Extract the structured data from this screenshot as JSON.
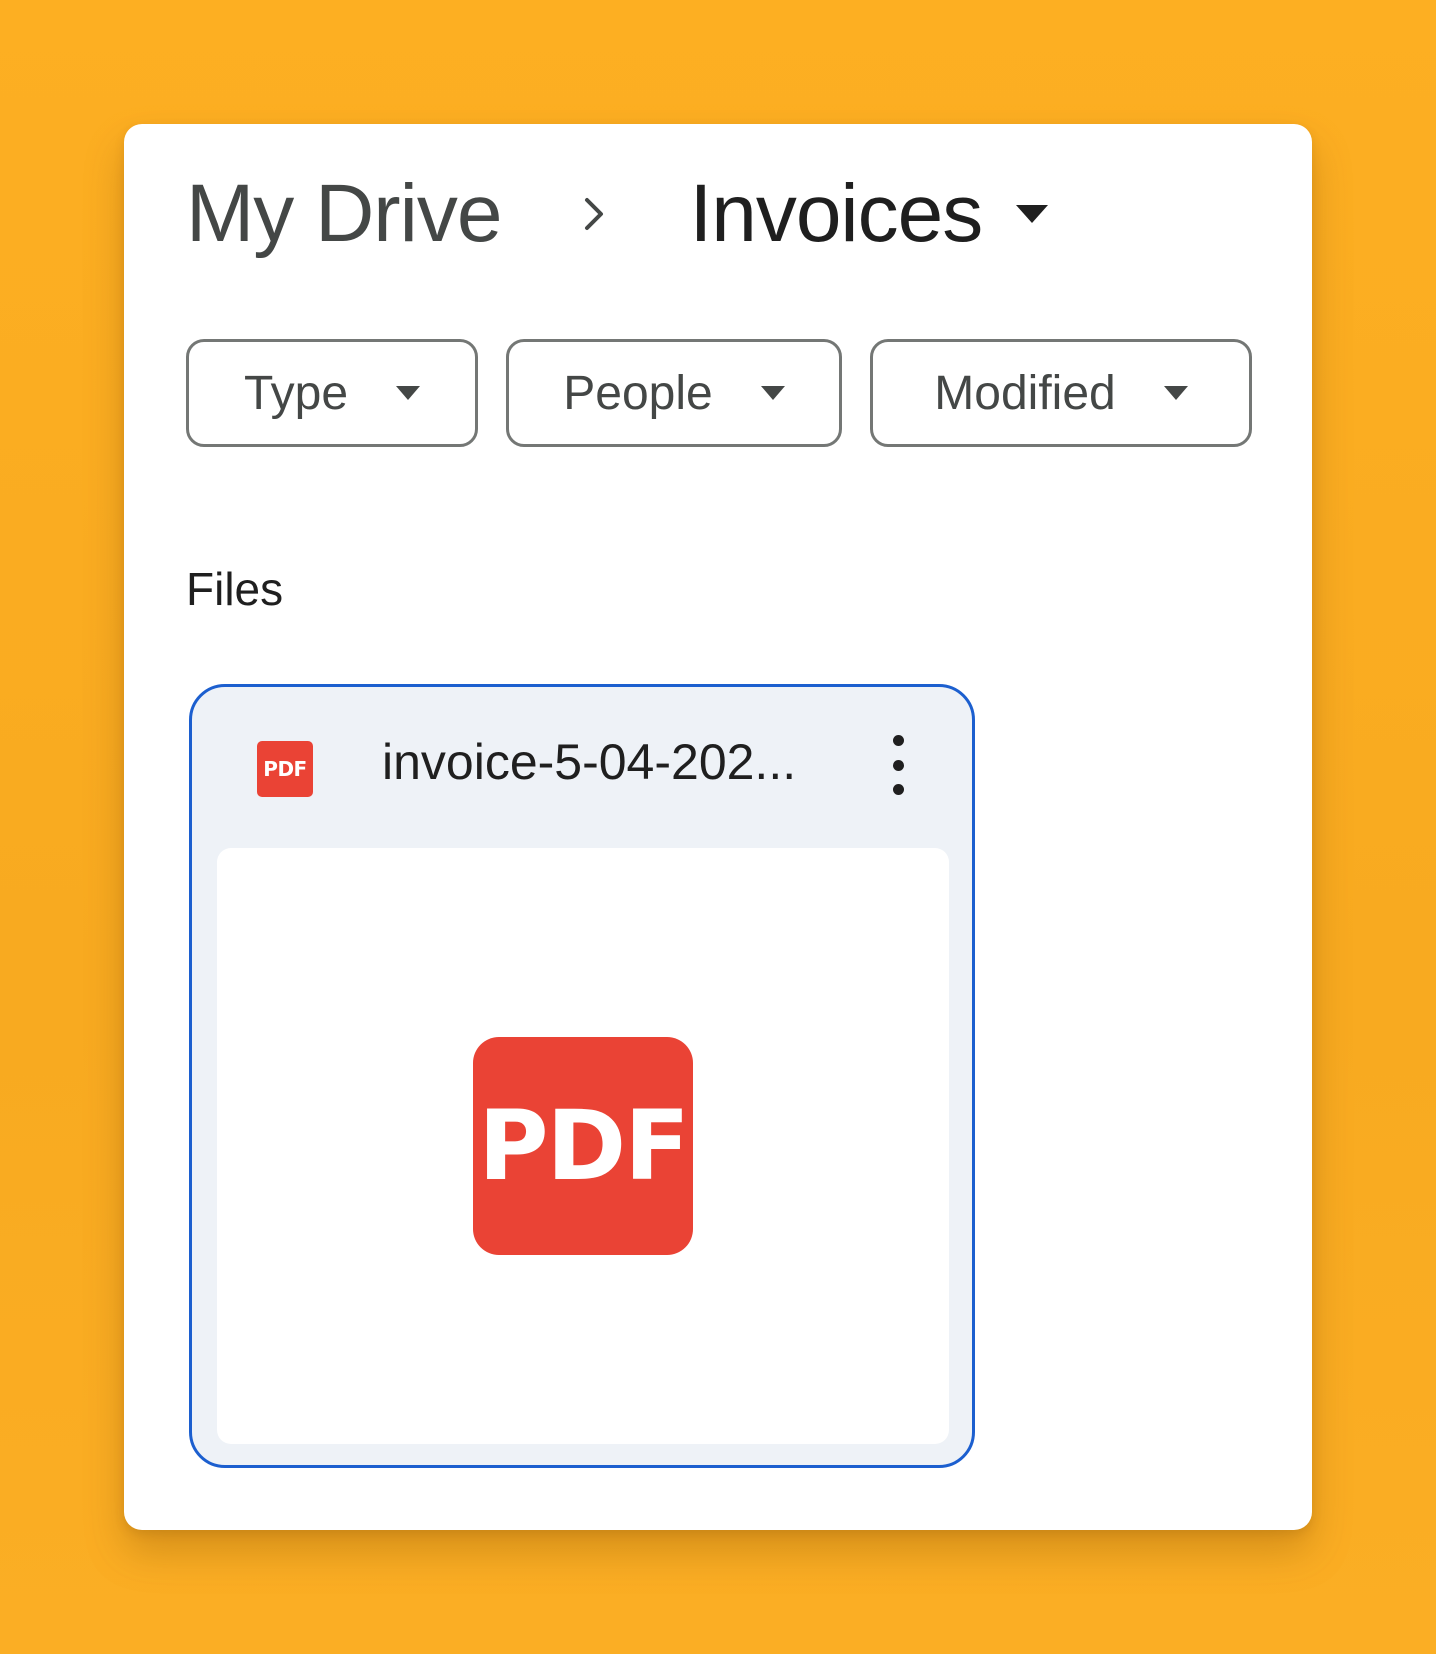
{
  "breadcrumb": {
    "root_label": "My Drive",
    "current_label": "Invoices"
  },
  "filters": {
    "type_label": "Type",
    "people_label": "People",
    "modified_label": "Modified"
  },
  "section": {
    "title": "Files"
  },
  "file": {
    "name": "invoice-5-04-202...",
    "type_badge": "PDF",
    "preview_badge": "PDF",
    "icon": "pdf-icon",
    "menu_icon": "more-vert-icon"
  },
  "colors": {
    "background": "#FDAF22",
    "pdf_red": "#EA4335",
    "selection_blue": "#1C5FCF",
    "card_bg": "#EEF2F7"
  }
}
